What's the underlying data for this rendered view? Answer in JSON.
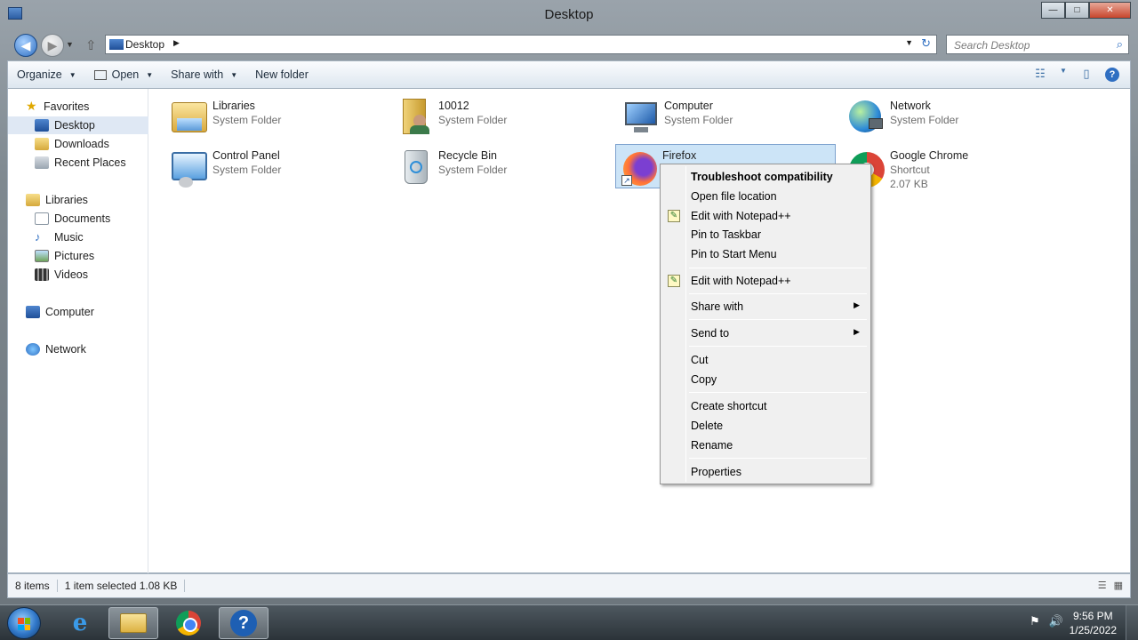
{
  "window": {
    "title": "Desktop",
    "min": "—",
    "max": "□",
    "close": "✕"
  },
  "address": {
    "location": "Desktop",
    "arrow": "▶",
    "dropdown": "▼",
    "refresh": "↻",
    "back": "◀",
    "forward": "▶",
    "nav_dropdown": "▼",
    "up": "⇧"
  },
  "search": {
    "placeholder": "Search Desktop",
    "icon": "⌕"
  },
  "toolbar": {
    "organize": "Organize",
    "open": "Open",
    "share_with": "Share with",
    "new_folder": "New folder",
    "caret": "▼",
    "views": "☷",
    "views_caret": "▼",
    "preview": "▯",
    "help": "?"
  },
  "navpane": {
    "favorites": "Favorites",
    "desktop": "Desktop",
    "downloads": "Downloads",
    "recent_places": "Recent Places",
    "libraries": "Libraries",
    "documents": "Documents",
    "music": "Music",
    "pictures": "Pictures",
    "videos": "Videos",
    "computer": "Computer",
    "network": "Network"
  },
  "files": {
    "libraries": {
      "name": "Libraries",
      "type": "System Folder"
    },
    "user": {
      "name": "10012",
      "type": "System Folder"
    },
    "computer": {
      "name": "Computer",
      "type": "System Folder"
    },
    "network": {
      "name": "Network",
      "type": "System Folder"
    },
    "control_panel": {
      "name": "Control Panel",
      "type": "System Folder"
    },
    "recycle_bin": {
      "name": "Recycle Bin",
      "type": "System Folder"
    },
    "firefox": {
      "name": "Firefox",
      "type": "Shortcut"
    },
    "chrome": {
      "name": "Google Chrome",
      "type": "Shortcut",
      "size": "2.07 KB"
    }
  },
  "context_menu": {
    "troubleshoot": "Troubleshoot compatibility",
    "open_file_location": "Open file location",
    "edit_notepad_1": "Edit with Notepad++",
    "pin_taskbar": "Pin to Taskbar",
    "pin_start": "Pin to Start Menu",
    "edit_notepad_2": "Edit with Notepad++",
    "share_with": "Share with",
    "send_to": "Send to",
    "cut": "Cut",
    "copy": "Copy",
    "create_shortcut": "Create shortcut",
    "delete": "Delete",
    "rename": "Rename",
    "properties": "Properties",
    "submenu_arrow": "▶"
  },
  "status": {
    "items": "8 items",
    "selected": "1 item selected  1.08 KB",
    "details_view": "☰",
    "tiles_view": "▦"
  },
  "taskbar": {
    "tray_flag": "⚑",
    "tray_volume": "🔊",
    "time": "9:56 PM",
    "date": "1/25/2022",
    "ie_letter": "e",
    "help_glyph": "?"
  }
}
